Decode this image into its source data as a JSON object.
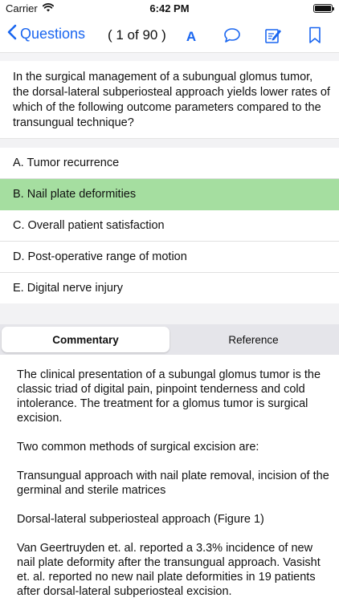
{
  "status_bar": {
    "carrier": "Carrier",
    "time": "6:42 PM"
  },
  "nav": {
    "back_label": "Questions",
    "counter": "( 1 of 90 )",
    "font_label": "A",
    "accent_color": "#1a66f0"
  },
  "question": {
    "text": "In the surgical management of a subungual glomus tumor, the dorsal-lateral subperiosteal approach yields lower rates of which of the following outcome parameters compared to the transungual technique?"
  },
  "answers": [
    {
      "label": "A. Tumor recurrence",
      "selected": false
    },
    {
      "label": "B. Nail plate deformities",
      "selected": true
    },
    {
      "label": "C. Overall patient satisfaction",
      "selected": false
    },
    {
      "label": "D. Post-operative range of motion",
      "selected": false
    },
    {
      "label": "E. Digital nerve injury",
      "selected": false
    }
  ],
  "tabs": [
    {
      "label": "Commentary",
      "active": true
    },
    {
      "label": "Reference",
      "active": false
    }
  ],
  "commentary": {
    "paragraphs": [
      "The clinical presentation of a subungal glomus tumor is the classic triad of digital pain, pinpoint tenderness and cold intolerance. The treatment for a glomus tumor is surgical excision.",
      "Two common methods of surgical excision are:",
      "Transungual approach with nail plate removal, incision of the germinal and sterile matrices",
      "Dorsal-lateral subperiosteal approach (Figure 1)",
      "Van Geertruyden et. al. reported a 3.3% incidence of new nail plate deformity after the transungual approach. Vasisht et. al. reported no new nail plate deformities in 19 patients after dorsal-lateral subperiosteal excision."
    ]
  },
  "colors": {
    "selected_answer": "#a5dea0",
    "segment_background": "#e5e5ea"
  }
}
